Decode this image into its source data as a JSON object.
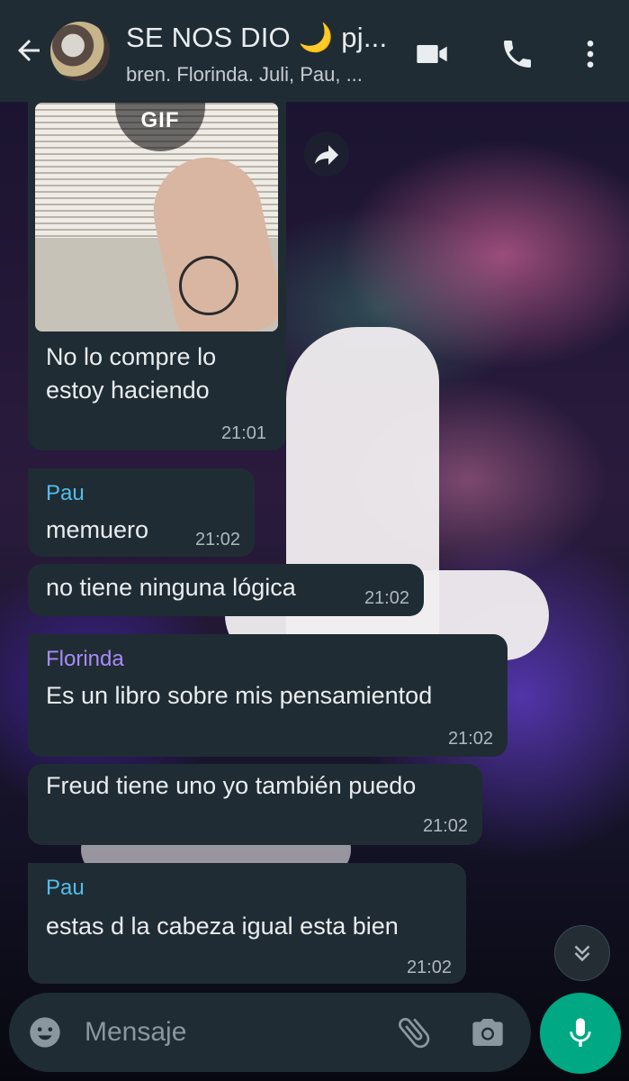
{
  "header": {
    "title": "SE NOS DIO 🌙 pj...",
    "subtitle": "bren, Florinda, Juli, Pau, ..."
  },
  "messages": [
    {
      "type": "gif",
      "badge": "GIF",
      "text_lines": [
        "No lo compre lo",
        "estoy haciendo"
      ],
      "time": "21:01"
    },
    {
      "sender": "Pau",
      "sender_color": "#53bdeb",
      "text": "memuero",
      "time": "21:02"
    },
    {
      "text": "no tiene ninguna lógica",
      "time": "21:02"
    },
    {
      "sender": "Florinda",
      "sender_color": "#a78bfa",
      "text": "Es un libro sobre mis pensamientod",
      "time": "21:02"
    },
    {
      "text": "Freud tiene uno yo también puedo",
      "time": "21:02"
    },
    {
      "sender": "Pau",
      "sender_color": "#53bdeb",
      "text": "estas d la cabeza igual esta bien",
      "time": "21:02"
    }
  ],
  "input": {
    "placeholder": "Mensaje"
  },
  "colors": {
    "header_bg": "#1f2c34",
    "bubble_bg": "#202c33",
    "accent": "#00a884"
  },
  "icons": [
    "back-arrow-icon",
    "video-call-icon",
    "phone-icon",
    "more-vert-icon",
    "share-icon",
    "scroll-down-icon",
    "emoji-icon",
    "attach-icon",
    "camera-icon",
    "mic-icon"
  ]
}
